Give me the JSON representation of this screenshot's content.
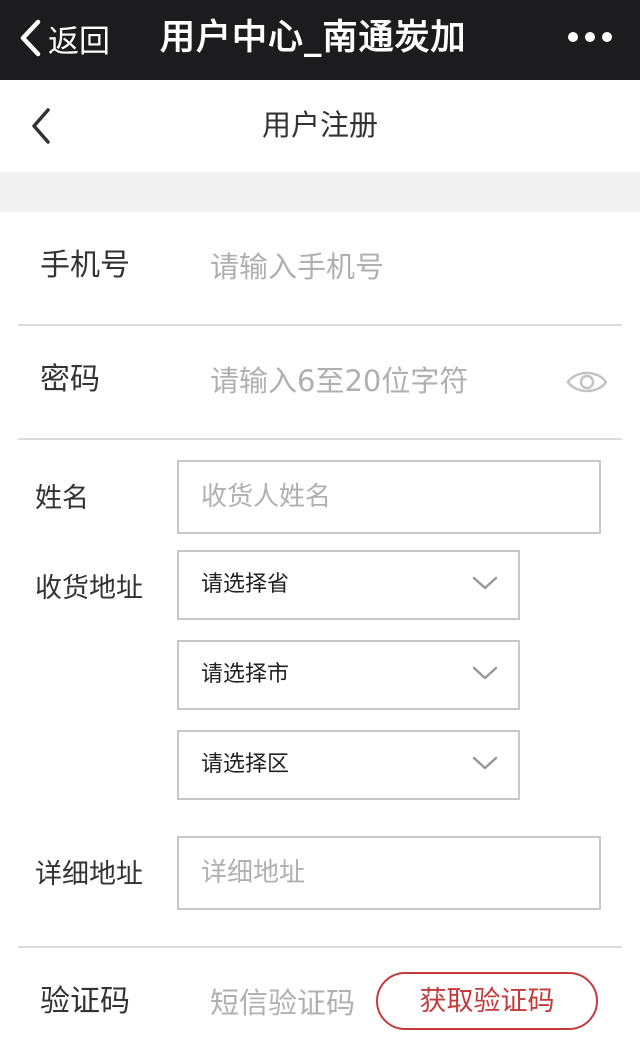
{
  "topbar": {
    "back_label": "返回",
    "title": "用户中心_南通炭加",
    "more_icon": "more-dots-icon"
  },
  "navbar": {
    "title": "用户注册",
    "back_icon": "chevron-left-icon"
  },
  "form": {
    "phone": {
      "label": "手机号",
      "placeholder": "请输入手机号"
    },
    "password": {
      "label": "密码",
      "placeholder": "请输入6至20位字符",
      "toggle_icon": "eye-icon"
    },
    "name": {
      "label": "姓名",
      "placeholder": "收货人姓名"
    },
    "address": {
      "label": "收货地址",
      "province": "请选择省",
      "city": "请选择市",
      "district": "请选择区",
      "dropdown_icon": "chevron-down-icon"
    },
    "detail": {
      "label": "详细地址",
      "placeholder": "详细地址"
    },
    "sms": {
      "label": "验证码",
      "placeholder": "短信验证码",
      "button": "获取验证码"
    }
  },
  "colors": {
    "topbar_bg": "#1c1c1e",
    "accent_red": "#c53a3a",
    "placeholder": "#b0b0b0",
    "section_gap": "#f0f0f0"
  }
}
